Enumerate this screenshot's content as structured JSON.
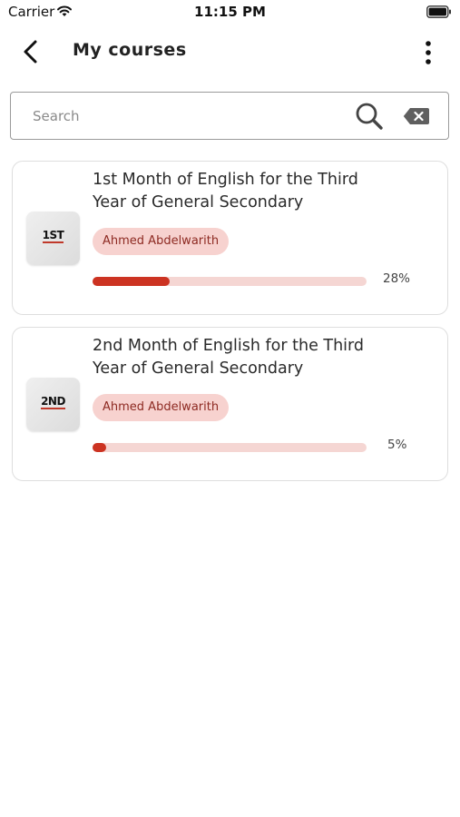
{
  "status_bar": {
    "carrier": "Carrier",
    "time": "11:15 PM"
  },
  "nav": {
    "title": "My courses"
  },
  "search": {
    "placeholder": "Search",
    "value": ""
  },
  "colors": {
    "accent": "#cc3322",
    "badge_bg": "#f7d2cf",
    "track_bg": "#f5d6d3"
  },
  "courses": [
    {
      "thumbnail_label": "1ST",
      "title": "1st Month of English for the Third Year of General Secondary",
      "instructor": "Ahmed Abdelwarith",
      "progress": 0.28,
      "progress_label": "28%"
    },
    {
      "thumbnail_label": "2ND",
      "title": "2nd Month of English for the Third Year of General Secondary",
      "instructor": "Ahmed Abdelwarith",
      "progress": 0.05,
      "progress_label": "5%"
    }
  ]
}
